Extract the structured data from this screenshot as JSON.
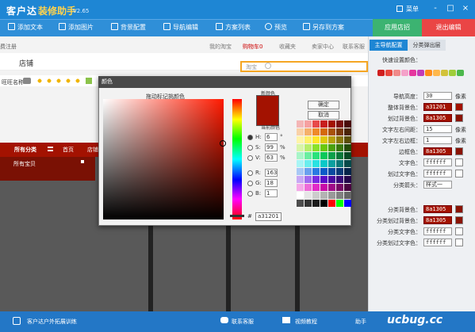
{
  "app": {
    "name": "客户达",
    "name2": "装修助手",
    "version": "V2.65",
    "menu": "菜单",
    "winbtns": [
      "-",
      "□",
      "×"
    ]
  },
  "toolbar": [
    {
      "label": "添加文本",
      "icon": "text-icon"
    },
    {
      "label": "添加图片",
      "icon": "image-icon"
    },
    {
      "label": "背景配置",
      "icon": "background-icon"
    },
    {
      "label": "导航编辑",
      "icon": "edit-icon"
    },
    {
      "label": "方案列表",
      "icon": "list-icon"
    },
    {
      "label": "预览",
      "icon": "eye-icon"
    },
    {
      "label": "另存到方案",
      "icon": "save-icon"
    }
  ],
  "actions": {
    "apply": "应用店招",
    "exit": "退出编辑"
  },
  "store": {
    "register": "费注册",
    "nav": [
      "我的淘宝",
      "购物车0",
      "收藏夹",
      "卖家中心",
      "联系客服"
    ],
    "shop": "店铺",
    "search_placeholder": "淘宝",
    "id_label": "淘宝",
    "wangwang": "旺旺名称",
    "menu": [
      "所有分类",
      "首页",
      "店铺"
    ],
    "submenu": "所有宝贝"
  },
  "status": {
    "left": "客户达户外拓展训练",
    "mid1": "联系客服",
    "mid2": "视频教程",
    "right": "助手",
    "watermark": "ucbug.cc"
  },
  "panel": {
    "tabs": [
      "主导航配置",
      "分类弹出层"
    ],
    "section": "快速设置颜色：",
    "quick_colors": [
      "#d01f1f",
      "#e9473d",
      "#f08a8a",
      "#f4a2c9",
      "#e5369e",
      "#c23bb8",
      "#ff8c1a",
      "#ffb84d",
      "#d2c23a",
      "#9fce3a",
      "#4cb84c"
    ],
    "rows": [
      {
        "label": "导航高度：",
        "value": "30",
        "unit": "像素"
      },
      {
        "label": "整体背景色：",
        "value": "a31201",
        "swatch": "#a31201"
      },
      {
        "label": "划过背景色：",
        "value": "8a1305",
        "swatch": "#8a1305"
      },
      {
        "label": "文字左右间距：",
        "value": "15",
        "unit": "像素"
      },
      {
        "label": "文字左右边框：",
        "value": "1",
        "unit": "像素"
      },
      {
        "label": "边框色：",
        "value": "8a1305",
        "swatch": "#8a1305"
      },
      {
        "label": "文字色：",
        "value": "ffffff",
        "swatch": "#ffffff"
      },
      {
        "label": "划过文字色：",
        "value": "ffffff",
        "swatch": "#ffffff"
      },
      {
        "label": "分类箭头：",
        "value": "样式一"
      }
    ],
    "rows2": [
      {
        "label": "分类背景色：",
        "value": "8a1305",
        "swatch": "#8a1305"
      },
      {
        "label": "分类划过背景色：",
        "value": "8a1305",
        "swatch": "#8a1305"
      },
      {
        "label": "分类文字色：",
        "value": "ffffff",
        "swatch": "#ffffff"
      },
      {
        "label": "分类划过文字色：",
        "value": "ffffff",
        "swatch": "#ffffff"
      }
    ]
  },
  "dialog": {
    "title": "颜色",
    "gradient_label": "拖动标记挑颜色",
    "new_label": "新颜色",
    "cur_label": "当前颜色",
    "ok": "确定",
    "cancel": "取消",
    "fields": [
      {
        "name": "H:",
        "value": "6",
        "unit": "°"
      },
      {
        "name": "S:",
        "value": "99",
        "unit": "%"
      },
      {
        "name": "V:",
        "value": "63",
        "unit": "%"
      },
      {
        "name": "R:",
        "value": "163",
        "unit": ""
      },
      {
        "name": "G:",
        "value": "18",
        "unit": ""
      },
      {
        "name": "B:",
        "value": "1",
        "unit": ""
      }
    ],
    "hash": "#",
    "hex": "a31201",
    "selected_color": "#a31201",
    "palette": [
      "#f4b6b6",
      "#f6a0a0",
      "#e84a4a",
      "#c81e1e",
      "#a31201",
      "#7a0f0f",
      "#4a0a0a",
      "#f9d1a8",
      "#f5b06a",
      "#ef8a2a",
      "#d46a0a",
      "#a8520a",
      "#7a3a0a",
      "#4a2406",
      "#fff4a8",
      "#fff06a",
      "#ffe62a",
      "#e0c80a",
      "#b8a00a",
      "#8a780a",
      "#5a4e06",
      "#d8f5a8",
      "#b8ee6a",
      "#8ae22a",
      "#6ac80a",
      "#4aa00a",
      "#3a780a",
      "#244a06",
      "#a8f5c8",
      "#6aeea0",
      "#2ae27a",
      "#0ac85a",
      "#0aa04a",
      "#0a783a",
      "#064a24",
      "#a8f5f5",
      "#6aeeee",
      "#2ae2e2",
      "#0ac8c8",
      "#0aa0a0",
      "#0a7878",
      "#064a4a",
      "#a8c8f5",
      "#6aa0ee",
      "#2a7ae2",
      "#0a5ac8",
      "#0a4aa0",
      "#0a3a78",
      "#06244a",
      "#c8a8f5",
      "#a06aee",
      "#7a2ae2",
      "#5a0ac8",
      "#4a0aa0",
      "#3a0a78",
      "#24064a",
      "#f5a8e8",
      "#ee6ad8",
      "#e22ac8",
      "#c80aa8",
      "#a00a88",
      "#780a66",
      "#4a0640",
      "#ffffff",
      "#e6e6e6",
      "#cccccc",
      "#b3b3b3",
      "#999999",
      "#808080",
      "#666666",
      "#4d4d4d",
      "#333333",
      "#1a1a1a",
      "#000000",
      "#ff0000",
      "#00ff00",
      "#0000ff"
    ]
  }
}
